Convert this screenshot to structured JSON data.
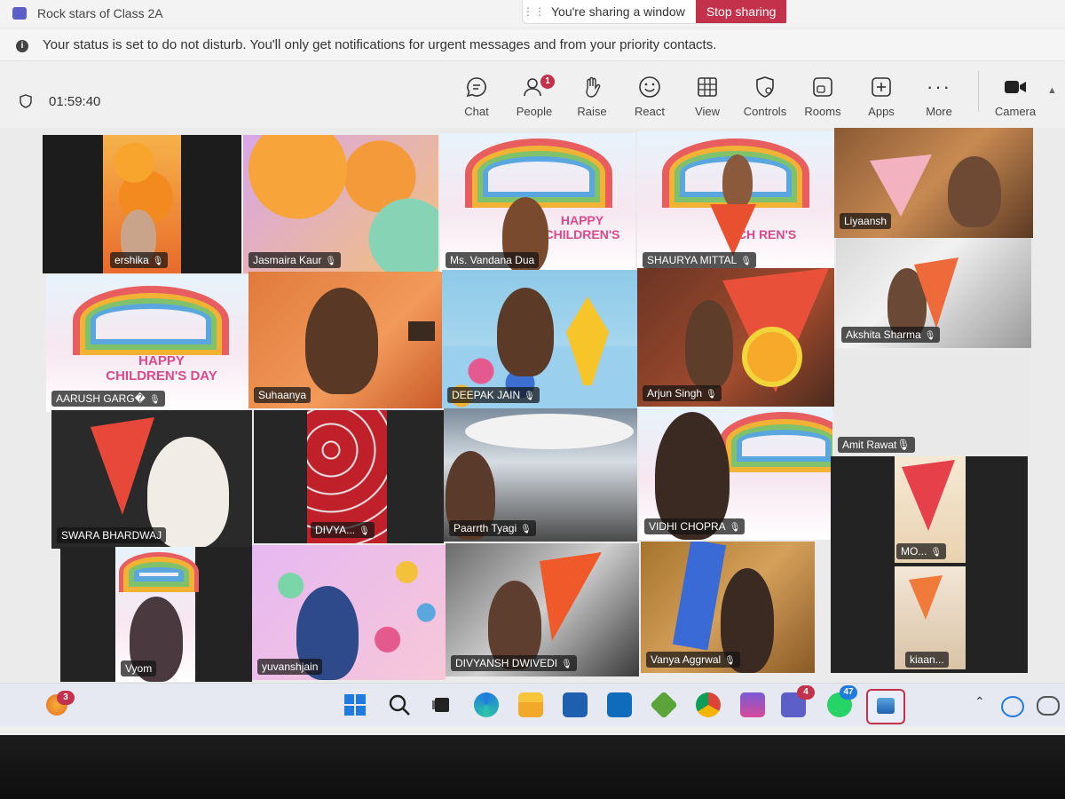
{
  "window": {
    "title": "Rock stars of Class 2A",
    "sharing_message": "You're sharing a window",
    "stop_sharing_label": "Stop sharing"
  },
  "banner": {
    "icon": "info-icon",
    "text": "Your status is set to do not disturb. You'll only get notifications for urgent messages and from your priority contacts."
  },
  "meeting": {
    "timer": "01:59:40"
  },
  "toolbar": {
    "items": [
      {
        "label": "Chat",
        "icon": "chat-icon"
      },
      {
        "label": "People",
        "icon": "people-icon",
        "badge": "1"
      },
      {
        "label": "Raise",
        "icon": "raise-hand-icon"
      },
      {
        "label": "React",
        "icon": "react-icon"
      },
      {
        "label": "View",
        "icon": "view-icon"
      },
      {
        "label": "Controls",
        "icon": "controls-icon"
      },
      {
        "label": "Rooms",
        "icon": "rooms-icon"
      },
      {
        "label": "Apps",
        "icon": "apps-icon"
      },
      {
        "label": "More",
        "icon": "more-icon"
      },
      {
        "label": "Camera",
        "icon": "camera-icon"
      }
    ]
  },
  "participants": [
    {
      "name": "ershika"
    },
    {
      "name": "Jasmaira Kaur"
    },
    {
      "name": "Ms. Vandana Dua"
    },
    {
      "name": "SHAURYA MITTAL"
    },
    {
      "name": "Liyaansh"
    },
    {
      "name": "AARUSH GARG�"
    },
    {
      "name": "Suhaanya"
    },
    {
      "name": "DEEPAK JAIN"
    },
    {
      "name": "Arjun Singh"
    },
    {
      "name": "Akshita Sharma"
    },
    {
      "name": "SWARA BHARDWAJ"
    },
    {
      "name": "DIVYA..."
    },
    {
      "name": "Paarrth Tyagi"
    },
    {
      "name": "VIDHI CHOPRA"
    },
    {
      "name": "Amit Rawat"
    },
    {
      "name": "MO..."
    },
    {
      "name": "Vyom"
    },
    {
      "name": "yuvanshjain"
    },
    {
      "name": "DIVYANSH DWIVEDI"
    },
    {
      "name": "Vanya Aggrwal"
    },
    {
      "name": "kiaan..."
    }
  ],
  "background_text": {
    "happy_childrens_day_1": "HAPPY CHILDREN'S DAY",
    "happy_childrens_day_2": "HAPPY CHILDREN'S",
    "childrens": "CH  REN'S"
  },
  "taskbar": {
    "start_badge": "3",
    "teams_badge": "4",
    "whatsapp_badge": "47"
  },
  "colors": {
    "stop_sharing": "#c4314b",
    "teams_accent": "#5b5fc7",
    "badge": "#c4314b"
  }
}
